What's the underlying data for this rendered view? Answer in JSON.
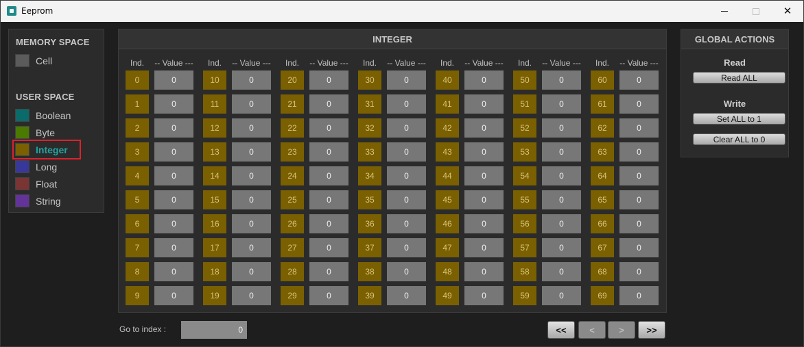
{
  "window": {
    "title": "Eeprom"
  },
  "memory_space": {
    "title": "MEMORY SPACE",
    "items": [
      {
        "label": "Cell",
        "color": "#5b5b5b"
      }
    ]
  },
  "user_space": {
    "title": "USER SPACE",
    "selected": "Integer",
    "items": [
      {
        "label": "Boolean",
        "color": "#0b6b6b"
      },
      {
        "label": "Byte",
        "color": "#4a7a00"
      },
      {
        "label": "Integer",
        "color": "#7a6000"
      },
      {
        "label": "Long",
        "color": "#38389a"
      },
      {
        "label": "Float",
        "color": "#7a3434"
      },
      {
        "label": "String",
        "color": "#63339a"
      }
    ]
  },
  "table": {
    "title": "INTEGER",
    "ind_header": "Ind.",
    "value_header": "-- Value ---",
    "indices": [
      [
        "0",
        "1",
        "2",
        "3",
        "4",
        "5",
        "6",
        "7",
        "8",
        "9"
      ],
      [
        "10",
        "11",
        "12",
        "13",
        "14",
        "15",
        "16",
        "17",
        "18",
        "19"
      ],
      [
        "20",
        "21",
        "22",
        "23",
        "24",
        "25",
        "26",
        "27",
        "28",
        "29"
      ],
      [
        "30",
        "31",
        "32",
        "33",
        "34",
        "35",
        "36",
        "37",
        "38",
        "39"
      ],
      [
        "40",
        "41",
        "42",
        "43",
        "44",
        "45",
        "46",
        "47",
        "48",
        "49"
      ],
      [
        "50",
        "51",
        "52",
        "53",
        "54",
        "55",
        "56",
        "57",
        "58",
        "59"
      ],
      [
        "60",
        "61",
        "62",
        "63",
        "64",
        "65",
        "66",
        "67",
        "68",
        "69"
      ]
    ],
    "values": [
      [
        "0",
        "0",
        "0",
        "0",
        "0",
        "0",
        "0",
        "0",
        "0",
        "0"
      ],
      [
        "0",
        "0",
        "0",
        "0",
        "0",
        "0",
        "0",
        "0",
        "0",
        "0"
      ],
      [
        "0",
        "0",
        "0",
        "0",
        "0",
        "0",
        "0",
        "0",
        "0",
        "0"
      ],
      [
        "0",
        "0",
        "0",
        "0",
        "0",
        "0",
        "0",
        "0",
        "0",
        "0"
      ],
      [
        "0",
        "0",
        "0",
        "0",
        "0",
        "0",
        "0",
        "0",
        "0",
        "0"
      ],
      [
        "0",
        "0",
        "0",
        "0",
        "0",
        "0",
        "0",
        "0",
        "0",
        "0"
      ],
      [
        "0",
        "0",
        "0",
        "0",
        "0",
        "0",
        "0",
        "0",
        "0",
        "0"
      ]
    ]
  },
  "global_actions": {
    "title": "GLOBAL ACTIONS",
    "read_title": "Read",
    "read_all": "Read ALL",
    "write_title": "Write",
    "set_all": "Set ALL to 1",
    "clear_all": "Clear ALL to 0"
  },
  "footer": {
    "goto_label": "Go to index :",
    "goto_value": "0",
    "first": "<<",
    "prev": "<",
    "next": ">",
    "last": ">>"
  }
}
